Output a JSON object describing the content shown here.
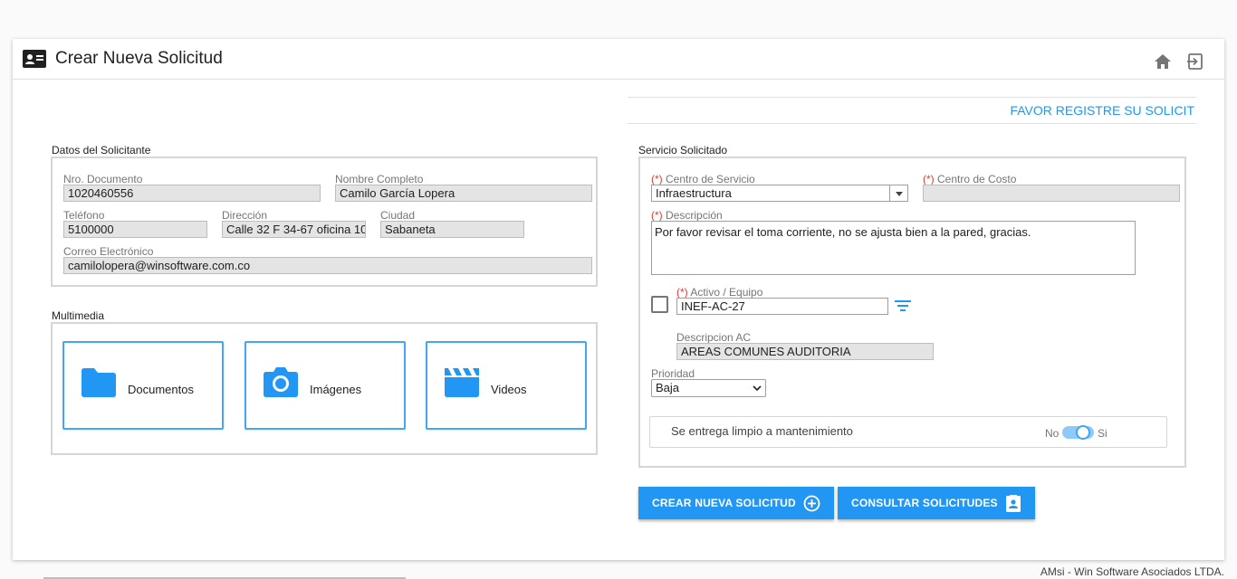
{
  "header": {
    "title": "Crear Nueva Solicitud",
    "title_icon": "id-card-icon",
    "home_icon": "home-icon",
    "exit_icon": "exit-icon"
  },
  "banner": {
    "text": "FAVOR REGISTRE SU SOLICIT"
  },
  "solicitante": {
    "legend": "Datos del Solicitante",
    "nro_documento": {
      "label": "Nro. Documento",
      "value": "1020460556"
    },
    "nombre_completo": {
      "label": "Nombre Completo",
      "value": "Camilo García Lopera"
    },
    "telefono": {
      "label": "Teléfono",
      "value": "5100000"
    },
    "direccion": {
      "label": "Dirección",
      "value": "Calle 32 F 34-67 oficina 10"
    },
    "ciudad": {
      "label": "Ciudad",
      "value": "Sabaneta"
    },
    "correo": {
      "label": "Correo Electrónico",
      "value": "camilolopera@winsoftware.com.co"
    }
  },
  "multimedia": {
    "legend": "Multimedia",
    "documentos": "Documentos",
    "imagenes": "Imágenes",
    "videos": "Videos"
  },
  "servicio": {
    "legend": "Servicio Solicitado",
    "required_mark": "(*)",
    "centro_servicio": {
      "label": "Centro de Servicio",
      "value": "Infraestructura"
    },
    "centro_costo": {
      "label": "Centro de Costo",
      "value": ""
    },
    "descripcion": {
      "label": "Descripción",
      "value": "Por favor revisar el toma corriente, no se ajusta bien a la pared, gracias."
    },
    "activo": {
      "label": "Activo / Equipo",
      "value": "INEF-AC-27",
      "checked": false
    },
    "descripcion_ac": {
      "label": "Descripcion AC",
      "value": "AREAS COMUNES AUDITORIA"
    },
    "prioridad": {
      "label": "Prioridad",
      "value": "Baja"
    },
    "entrega": {
      "label": "Se entrega limpio a mantenimiento",
      "off_label": "No",
      "on_label": "Si",
      "value": true
    }
  },
  "buttons": {
    "crear": "CREAR NUEVA SOLICITUD",
    "consultar": "CONSULTAR SOLICITUDES"
  },
  "footer": {
    "text": "AMsi - Win Software Asociados LTDA."
  },
  "colors": {
    "accent": "#2196f3",
    "required": "#e53935"
  }
}
